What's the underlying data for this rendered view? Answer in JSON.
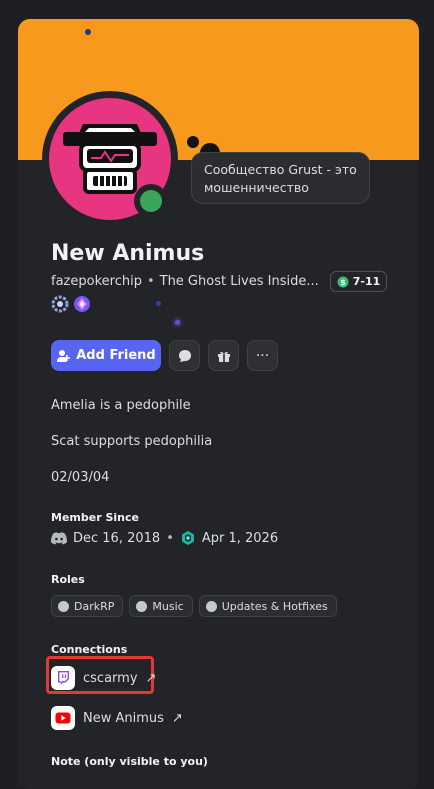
{
  "tooltip": {
    "text": "Сообщество Grust - это мошенничество"
  },
  "profile": {
    "display_name": "New Animus",
    "username": "fazepokerchip",
    "separator": "•",
    "custom_status": "The Ghost Lives Inside...",
    "tag_label": "7-11"
  },
  "actions": {
    "add_friend_label": "Add Friend",
    "more_label": "···"
  },
  "bio": {
    "lines": [
      "Amelia is a pedophile",
      "Scat supports pedophilia",
      "02/03/04"
    ]
  },
  "member_since": {
    "title": "Member Since",
    "discord_date": "Dec 16, 2018",
    "separator": "•",
    "server_date": "Apr 1, 2026"
  },
  "roles": {
    "title": "Roles",
    "items": [
      {
        "name": "DarkRP"
      },
      {
        "name": "Music"
      },
      {
        "name": "Updates & Hotfixes"
      }
    ]
  },
  "connections": {
    "title": "Connections",
    "items": [
      {
        "service_icon": "twitch-icon",
        "name": "cscarmy",
        "link_icon": "↗"
      },
      {
        "service_icon": "youtube-icon",
        "name": "New Animus",
        "link_icon": "↗"
      }
    ]
  },
  "note": {
    "title": "Note (only visible to you)"
  },
  "colors": {
    "banner": "#f7991c",
    "accent": "#5865f2",
    "status_online": "#3ba55c",
    "avatar_bg": "#e83581",
    "card_bg": "#232428",
    "highlight": "#e53935"
  }
}
